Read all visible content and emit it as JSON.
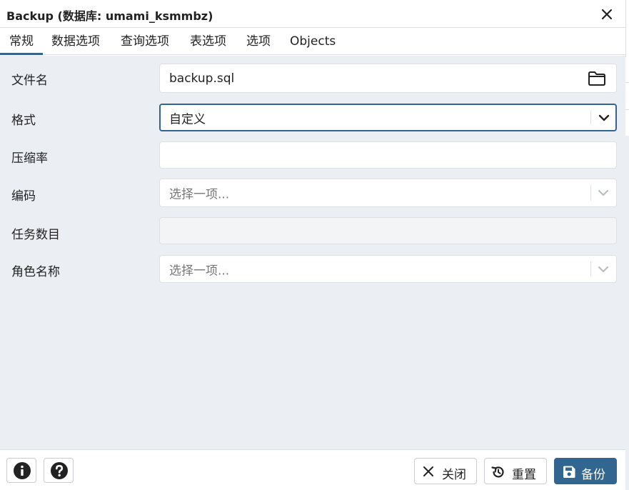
{
  "dialog": {
    "title": "Backup (数据库: umami_ksmmbz)",
    "close_icon": "close-icon"
  },
  "tabs": [
    {
      "label": "常规",
      "active": true
    },
    {
      "label": "数据选项",
      "active": false
    },
    {
      "label": "查询选项",
      "active": false
    },
    {
      "label": "表选项",
      "active": false
    },
    {
      "label": "选项",
      "active": false
    },
    {
      "label": "Objects",
      "active": false
    }
  ],
  "form": {
    "filename": {
      "label": "文件名",
      "value": "backup.sql",
      "icon": "folder-icon"
    },
    "format": {
      "label": "格式",
      "value": "自定义"
    },
    "compression": {
      "label": "压缩率",
      "value": ""
    },
    "encoding": {
      "label": "编码",
      "placeholder": "选择一项..."
    },
    "jobs": {
      "label": "任务数目",
      "value": ""
    },
    "role": {
      "label": "角色名称",
      "placeholder": "选择一项..."
    }
  },
  "footer": {
    "info_icon": "info-icon",
    "help_icon": "help-icon",
    "close_label": "关闭",
    "reset_label": "重置",
    "backup_label": "备份"
  },
  "colors": {
    "accent": "#326690",
    "panel_bg": "#ebeef3",
    "border": "#dde0e6"
  }
}
